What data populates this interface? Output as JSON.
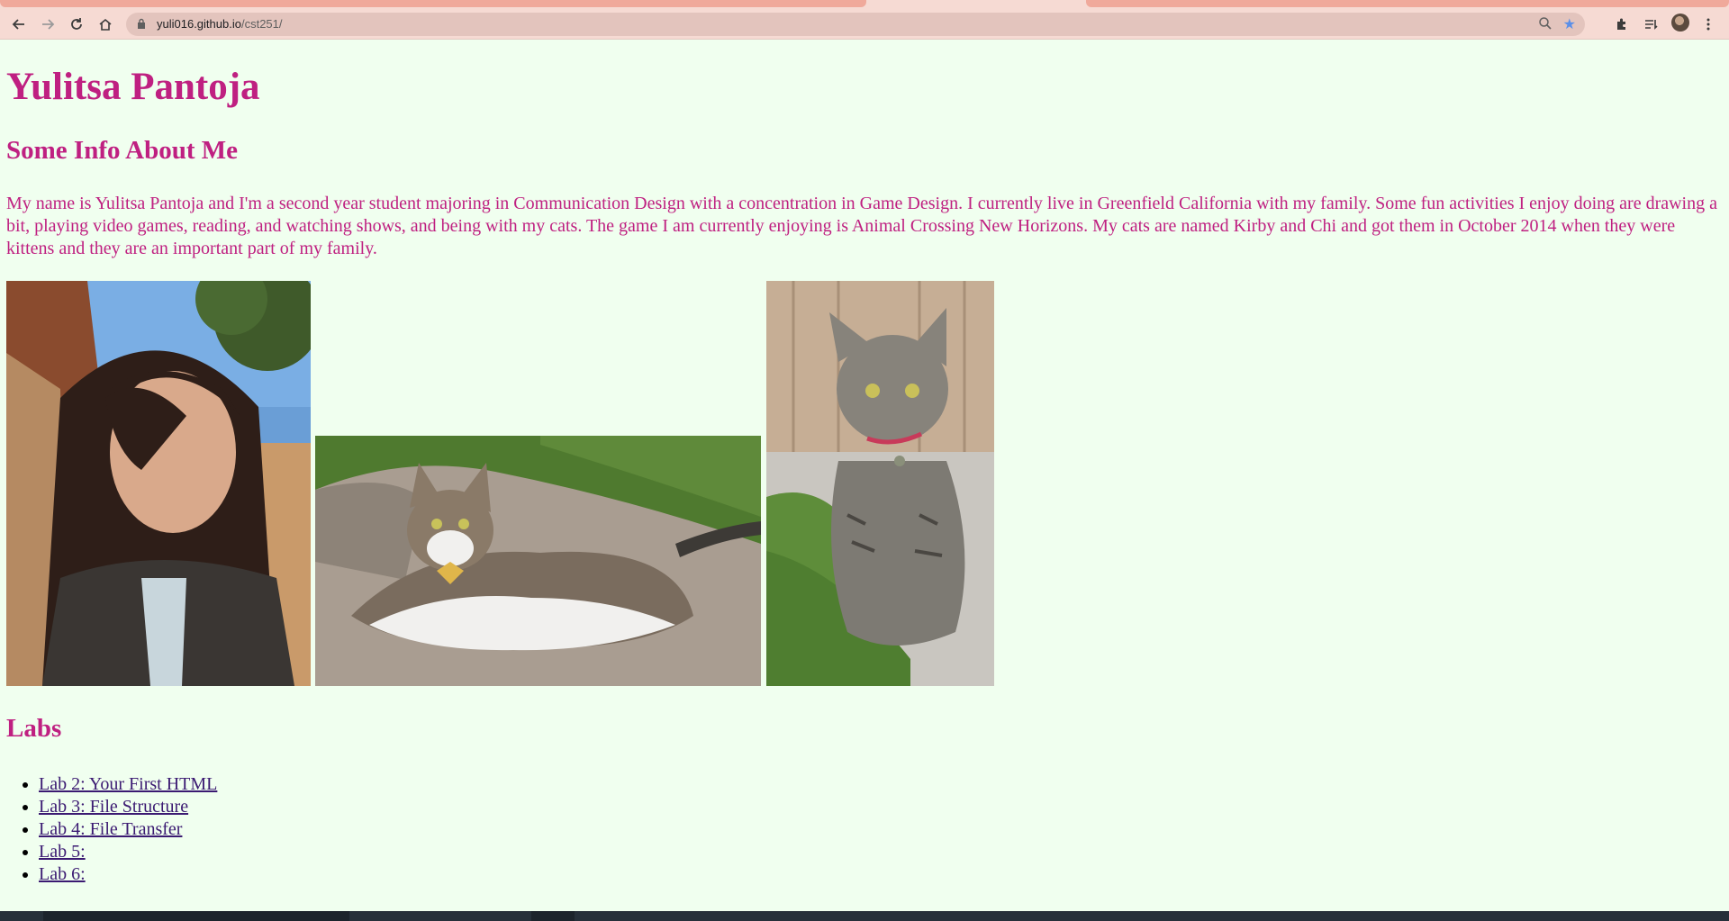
{
  "browser": {
    "url_host": "yuli016.github.io",
    "url_path": "/cst251/",
    "icons": [
      "back-icon",
      "forward-icon",
      "reload-icon",
      "home-icon",
      "lock-icon",
      "zoom-icon",
      "star-icon",
      "extensions-icon",
      "reading-list-icon",
      "menu-icon"
    ]
  },
  "page": {
    "title": "Yulitsa Pantoja",
    "about_heading": "Some Info About Me",
    "bio": "My name is Yulitsa Pantoja and I'm a second year student majoring in Communication Design with a concentration in Game Design. I currently live in Greenfield California with my family. Some fun activities I enjoy doing are drawing a bit, playing video games, reading, and watching shows, and being with my cats. The game I am currently enjoying is Animal Crossing New Horizons. My cats are named Kirby and Chi and got them in October 2014 when they were kittens and they are an important part of my family.",
    "labs_heading": "Labs",
    "labs": [
      {
        "label": "Lab 2: Your First HTML"
      },
      {
        "label": "Lab 3: File Structure"
      },
      {
        "label": "Lab 4: File Transfer"
      },
      {
        "label": "Lab 5:"
      },
      {
        "label": "Lab 6:"
      }
    ]
  },
  "colors": {
    "page_bg": "#f0ffef",
    "heading": "#bf2081",
    "link": "#3b1a72",
    "chrome": "#f6dad3"
  }
}
